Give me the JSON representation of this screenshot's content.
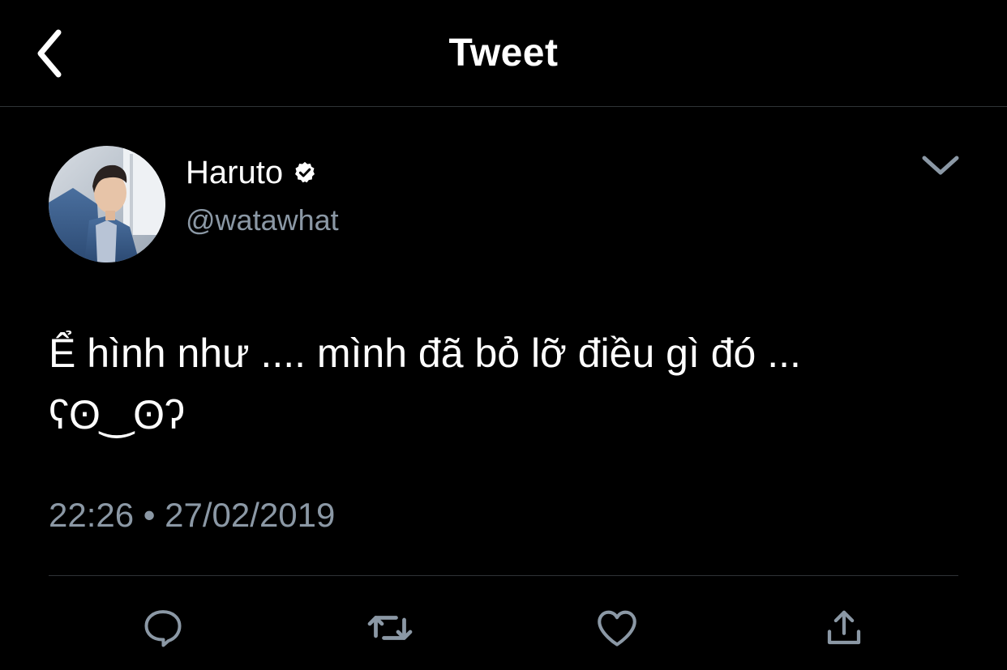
{
  "header": {
    "title": "Tweet",
    "back_icon": "chevron-left-icon"
  },
  "tweet": {
    "author": {
      "display_name": "Haruto",
      "handle": "@watawhat",
      "verified": true
    },
    "text": "Ể hình như .... mình đã bỏ lỡ điều gì đó ...\nʕʘ‿ʘʔ",
    "time": "22:26",
    "separator": "•",
    "date": "27/02/2019"
  },
  "actions": [
    {
      "name": "reply",
      "icon": "reply-icon"
    },
    {
      "name": "retweet",
      "icon": "retweet-icon"
    },
    {
      "name": "like",
      "icon": "heart-icon"
    },
    {
      "name": "share",
      "icon": "share-icon"
    }
  ],
  "colors": {
    "background": "#000000",
    "text": "#ffffff",
    "secondary_text": "#8b98a5",
    "divider": "#2f3336",
    "icon": "#8b98a5"
  }
}
